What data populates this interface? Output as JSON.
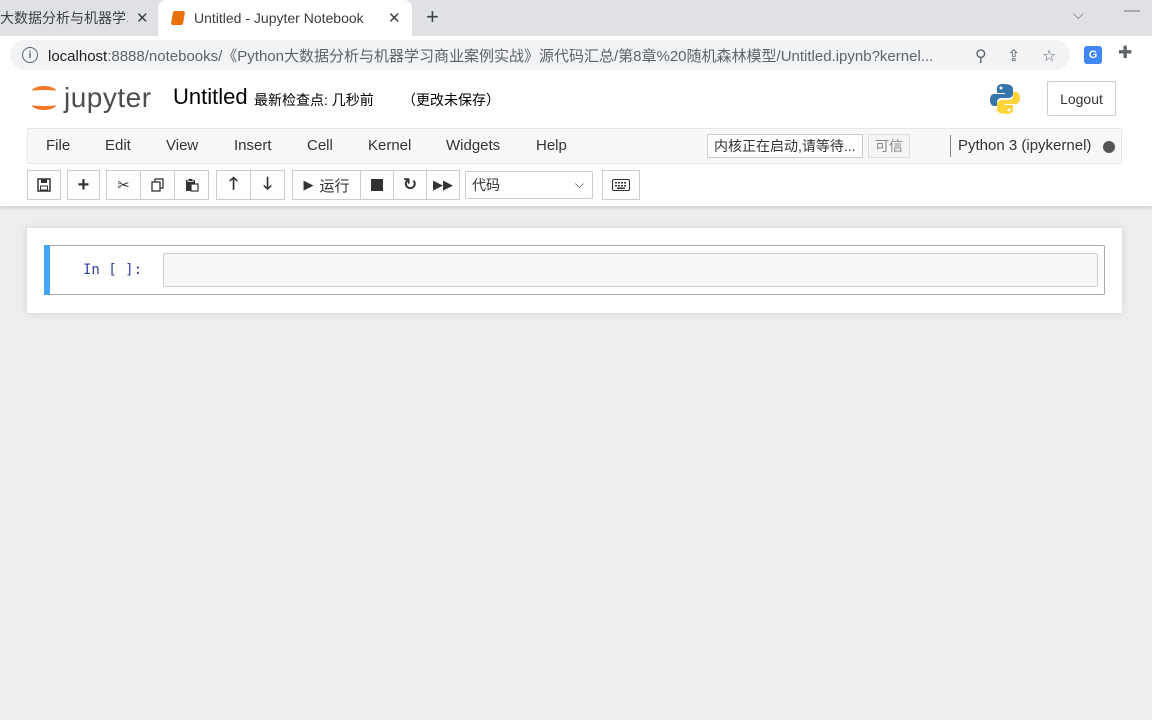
{
  "browser": {
    "tabs": [
      {
        "title": "大数据分析与机器学习",
        "active": false
      },
      {
        "title": "Untitled - Jupyter Notebook",
        "active": true
      }
    ],
    "close_glyph": "✕",
    "new_tab_glyph": "+",
    "url_host": "localhost",
    "url_path": ":8888/notebooks/《Python大数据分析与机器学习商业案例实战》源代码汇总/第8章%20随机森林模型/Untitled.ipynb?kernel..."
  },
  "header": {
    "logo_text": "jupyter",
    "notebook_title": "Untitled",
    "checkpoint": "最新检查点: 几秒前",
    "unsaved": "（更改未保存）",
    "logout_label": "Logout"
  },
  "menubar": {
    "items": [
      "File",
      "Edit",
      "View",
      "Insert",
      "Cell",
      "Kernel",
      "Widgets",
      "Help"
    ],
    "kernel_status": "内核正在启动,请等待...",
    "trusted": "可信",
    "kernel_name": "Python 3 (ipykernel)"
  },
  "toolbar": {
    "run_label": "运行",
    "cell_type": "代码"
  },
  "cell": {
    "prompt": "In [ ]:",
    "source": ""
  },
  "colors": {
    "selected_cell_bar": "#42a5f5",
    "jupyter_orange": "#f37726",
    "prompt_blue": "#303f9f"
  }
}
